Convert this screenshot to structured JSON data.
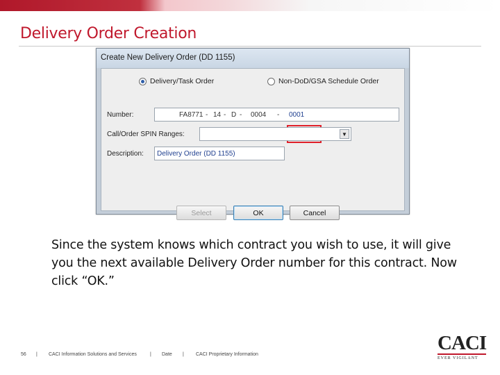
{
  "slide": {
    "title": "Delivery Order Creation",
    "caption": "Since the system knows which contract you wish to use, it will give you the next available Delivery Order number for this contract.  Now click “OK.”"
  },
  "dialog": {
    "title": "Create New Delivery Order (DD 1155)",
    "radio_options": [
      {
        "label": "Delivery/Task Order",
        "selected": true
      },
      {
        "label": "Non-DoD/GSA Schedule Order",
        "selected": false
      }
    ],
    "number_label": "Number:",
    "number_segments": [
      "FA8771",
      "-",
      "14",
      "-",
      "D",
      "-",
      "0004",
      "-",
      "0001"
    ],
    "spin_label": "Call/Order SPIN Ranges:",
    "spin_value": "",
    "description_label": "Description:",
    "description_value": "Delivery Order (DD 1155)",
    "buttons": {
      "select": "Select",
      "ok": "OK",
      "cancel": "Cancel"
    },
    "highlight_color": "#e0202a"
  },
  "footer": {
    "page_number": "56",
    "separator": "|",
    "company": "CACI Information Solutions and Services",
    "date": "Date",
    "proprietary": "CACI Proprietary Information"
  },
  "logo": {
    "name": "CACI",
    "tagline": "EVER VIGILANT"
  },
  "colors": {
    "accent": "#c0182c"
  }
}
